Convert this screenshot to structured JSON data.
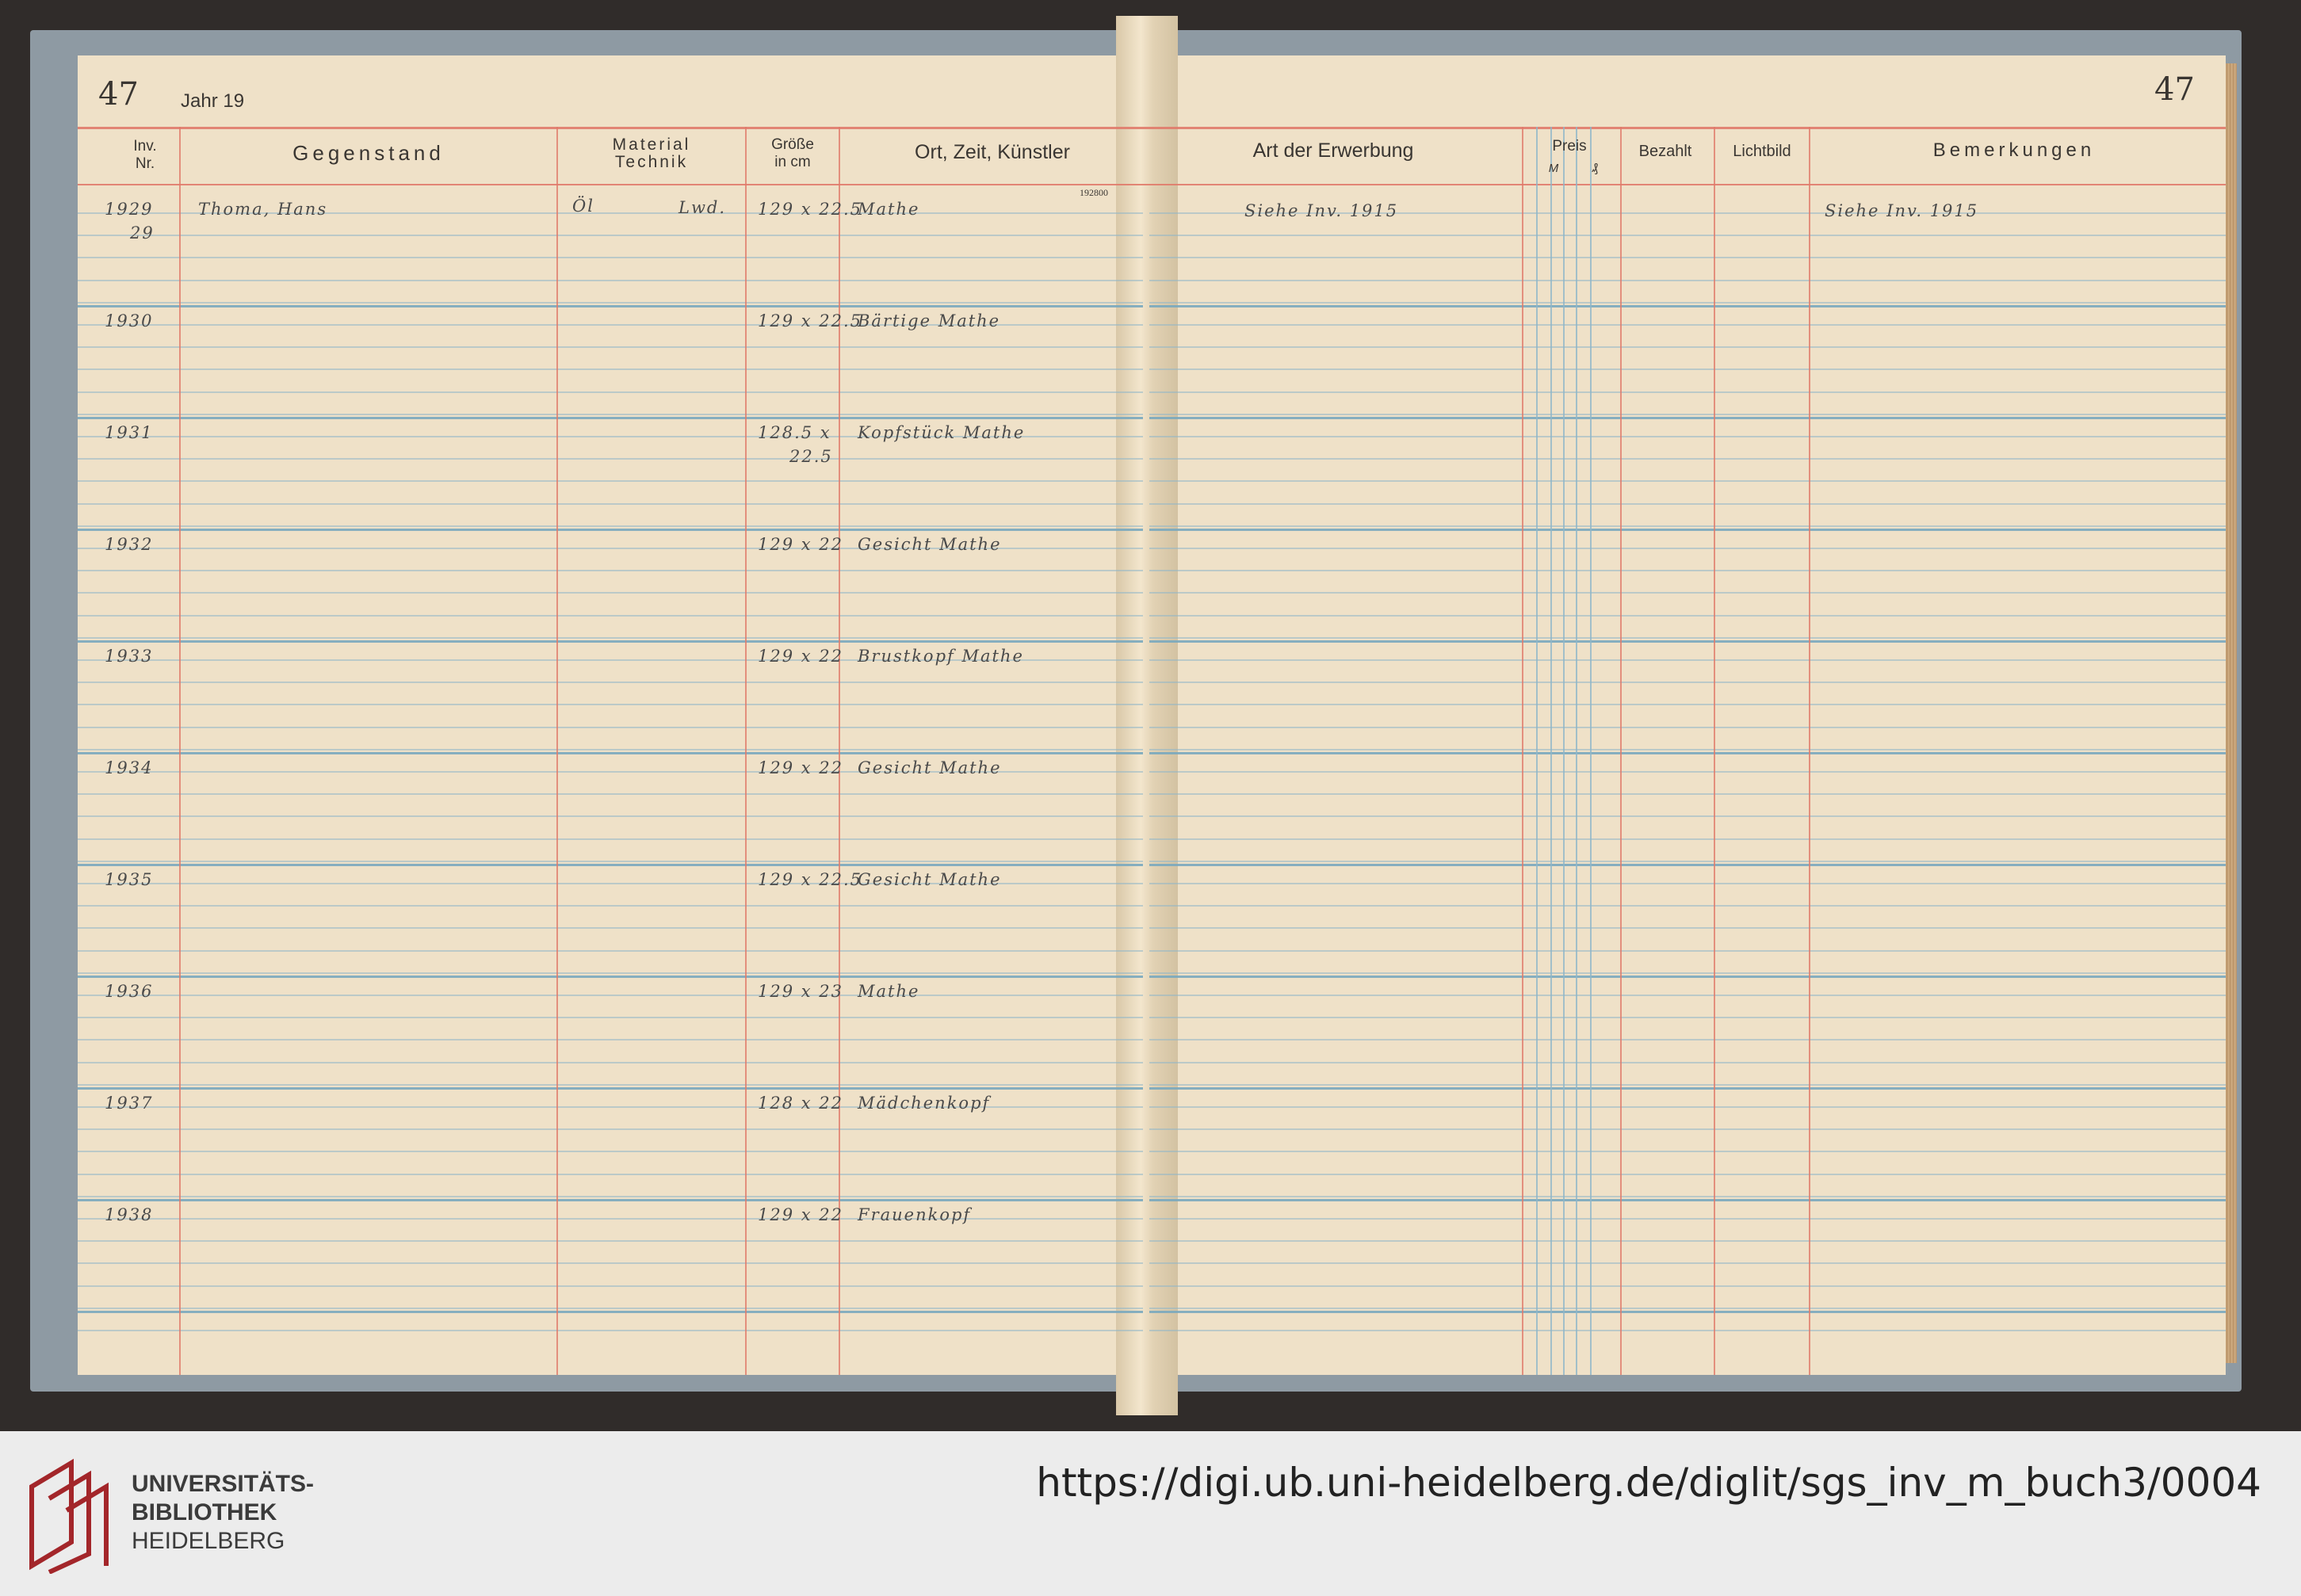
{
  "page": {
    "number_left": "47",
    "number_right": "47",
    "year_label": "Jahr 19",
    "stamp": "192800"
  },
  "columns_left": {
    "inv_nr": "Inv.\nNr.",
    "gegenstand": "Gegenstand",
    "material": "Material\nTechnik",
    "groesse": "Größe\nin cm",
    "ort": "Ort, Zeit, Künstler"
  },
  "columns_right": {
    "erwerbung": "Art der Erwerbung",
    "preis": "Preis",
    "preis_m": "M",
    "preis_pf": "₰",
    "bezahlt": "Bezahlt",
    "lichtbild": "Lichtbild",
    "bemerkungen": "Bemerkungen"
  },
  "entries": [
    {
      "nr": "1929",
      "nr2": "29",
      "gegenstand": "Thoma, Hans",
      "material": "Öl",
      "technik": "Lwd.",
      "groesse": "129 x 22.5",
      "ort": "Mathe",
      "erwerbung": "Siehe Inv. 1915",
      "bemerkung": "Siehe Inv. 1915"
    },
    {
      "nr": "1930",
      "groesse": "129 x 22.5",
      "ort": "Bärtige Mathe"
    },
    {
      "nr": "1931",
      "groesse": "128.5 x",
      "groesse2": "22.5",
      "ort": "Kopfstück Mathe"
    },
    {
      "nr": "1932",
      "groesse": "129 x 22",
      "ort": "Gesicht Mathe"
    },
    {
      "nr": "1933",
      "groesse": "129 x 22",
      "ort": "Brustkopf Mathe"
    },
    {
      "nr": "1934",
      "groesse": "129 x 22",
      "ort": "Gesicht Mathe"
    },
    {
      "nr": "1935",
      "groesse": "129 x 22.5",
      "ort": "Gesicht Mathe"
    },
    {
      "nr": "1936",
      "groesse": "129 x 23",
      "ort": "Mathe"
    },
    {
      "nr": "1937",
      "groesse": "128 x 22",
      "ort": "Mädchenkopf"
    },
    {
      "nr": "1938",
      "groesse": "129 x 22",
      "ort": "Frauenkopf"
    }
  ],
  "footer": {
    "library_line1": "UNIVERSITÄTS-",
    "library_line2": "BIBLIOTHEK",
    "library_line3": "HEIDELBERG",
    "url": "https://digi.ub.uni-heidelberg.de/diglit/sgs_inv_m_buch3/0004"
  },
  "colors": {
    "paper": "#efe1c8",
    "ruling_blue": "#8fb7c9",
    "ruling_red": "#e07a6a",
    "logo_red": "#a3262a"
  }
}
